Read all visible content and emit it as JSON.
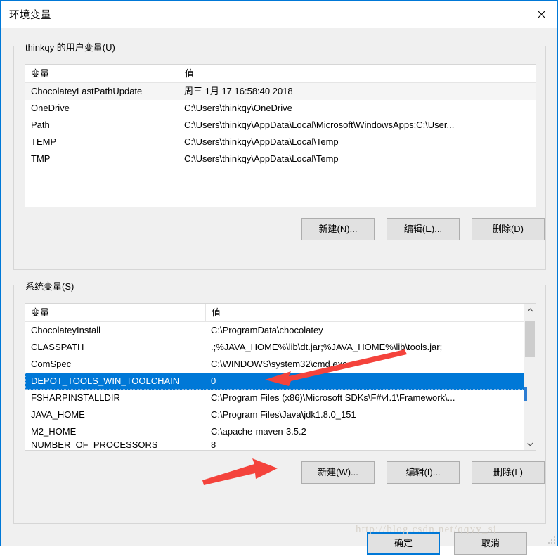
{
  "window": {
    "title": "环境变量",
    "close_icon": "close-icon"
  },
  "user_section": {
    "legend": "thinkqy 的用户变量(U)",
    "columns": [
      "变量",
      "值"
    ],
    "rows": [
      {
        "name": "ChocolateyLastPathUpdate",
        "value": "周三 1月 17 16:58:40 2018",
        "state": "hover"
      },
      {
        "name": "OneDrive",
        "value": "C:\\Users\\thinkqy\\OneDrive",
        "state": ""
      },
      {
        "name": "Path",
        "value": "C:\\Users\\thinkqy\\AppData\\Local\\Microsoft\\WindowsApps;C:\\User...",
        "state": ""
      },
      {
        "name": "TEMP",
        "value": "C:\\Users\\thinkqy\\AppData\\Local\\Temp",
        "state": ""
      },
      {
        "name": "TMP",
        "value": "C:\\Users\\thinkqy\\AppData\\Local\\Temp",
        "state": ""
      }
    ],
    "buttons": {
      "new": "新建(N)...",
      "edit": "编辑(E)...",
      "delete": "删除(D)"
    }
  },
  "system_section": {
    "legend": "系统变量(S)",
    "columns": [
      "变量",
      "值"
    ],
    "rows": [
      {
        "name": "ChocolateyInstall",
        "value": "C:\\ProgramData\\chocolatey",
        "state": ""
      },
      {
        "name": "CLASSPATH",
        "value": ".;%JAVA_HOME%\\lib\\dt.jar;%JAVA_HOME%\\lib\\tools.jar;",
        "state": ""
      },
      {
        "name": "ComSpec",
        "value": "C:\\WINDOWS\\system32\\cmd.exe",
        "state": ""
      },
      {
        "name": "DEPOT_TOOLS_WIN_TOOLCHAIN",
        "value": "0",
        "state": "selected"
      },
      {
        "name": "FSHARPINSTALLDIR",
        "value": "C:\\Program Files (x86)\\Microsoft SDKs\\F#\\4.1\\Framework\\...",
        "state": ""
      },
      {
        "name": "JAVA_HOME",
        "value": "C:\\Program Files\\Java\\jdk1.8.0_151",
        "state": ""
      },
      {
        "name": "M2_HOME",
        "value": "C:\\apache-maven-3.5.2",
        "state": ""
      },
      {
        "name": "NUMBER_OF_PROCESSORS",
        "value": "8",
        "state": "clipped"
      }
    ],
    "buttons": {
      "new": "新建(W)...",
      "edit": "编辑(I)...",
      "delete": "删除(L)"
    },
    "scrollbar": {
      "up_icon": "chevron-up-icon",
      "down_icon": "chevron-down-icon"
    }
  },
  "footer": {
    "ok": "确定",
    "cancel": "取消"
  },
  "watermark": "http://blog.csdn.net/qqyy_sj",
  "colors": {
    "accent": "#0078d7",
    "selection": "#0078d7",
    "annotation_arrow": "#f4433c",
    "dialog_bg": "#f0f0f0",
    "button_bg": "#e1e1e1"
  }
}
